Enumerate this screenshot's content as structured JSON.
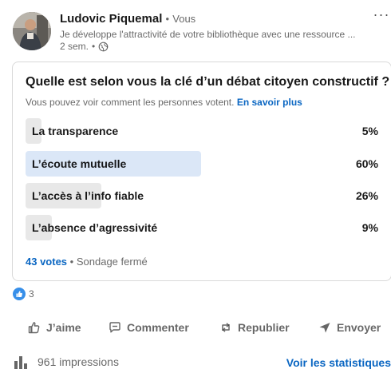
{
  "post": {
    "author_name": "Ludovic Piquemal",
    "author_separator": "•",
    "author_badge": "Vous",
    "headline": "Je développe l'attractivité de votre bibliothèque avec une ressource ...",
    "time": "2 sem.",
    "time_separator": "•",
    "visibility_icon": "globe-icon",
    "more_icon": "more-horizontal-icon",
    "more_label": "···"
  },
  "poll": {
    "question": "Quelle est selon vous la clé d’un débat citoyen constructif ?",
    "note": "Vous pouvez voir comment les personnes votent.",
    "note_link": "En savoir plus",
    "options": [
      {
        "label": "La transparence",
        "percent_label": "5%",
        "percent": 5,
        "selected": false
      },
      {
        "label": "L’écoute mutuelle",
        "percent_label": "60%",
        "percent": 60,
        "selected": true
      },
      {
        "label": "L’accès à l’info fiable",
        "percent_label": "26%",
        "percent": 26,
        "selected": false
      },
      {
        "label": "L’absence d’agressivité",
        "percent_label": "9%",
        "percent": 9,
        "selected": false
      }
    ],
    "votes": "43 votes",
    "status_separator": "•",
    "status": "Sondage fermé"
  },
  "reactions": {
    "icon": "like-icon",
    "count": "3"
  },
  "actions": {
    "like": "J’aime",
    "comment": "Commenter",
    "repost": "Republier",
    "send": "Envoyer"
  },
  "footer": {
    "impressions": "961 impressions",
    "stats_link": "Voir les statistiques"
  },
  "colors": {
    "accent": "#0a66c2",
    "selected_bar": "#dbe7f7",
    "bar": "#e8e8e8",
    "like": "#378fe9"
  }
}
